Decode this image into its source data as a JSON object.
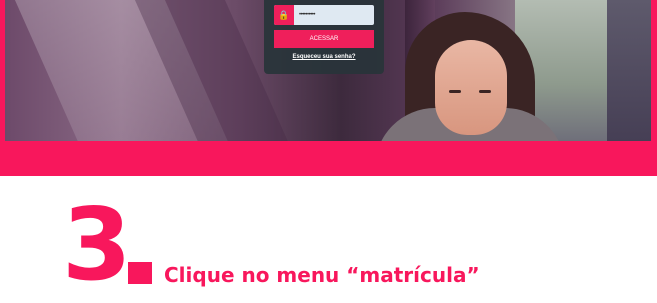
{
  "login": {
    "password_value": "••••••••••",
    "submit_label": "ACESSAR",
    "forgot_link": "Esqueceu sua senha?"
  },
  "step": {
    "number": "3",
    "text": "Clique no menu “matrícula”"
  },
  "colors": {
    "brand": "#f8175c",
    "card": "#28343a"
  },
  "icons": {
    "password": "lock-icon"
  }
}
